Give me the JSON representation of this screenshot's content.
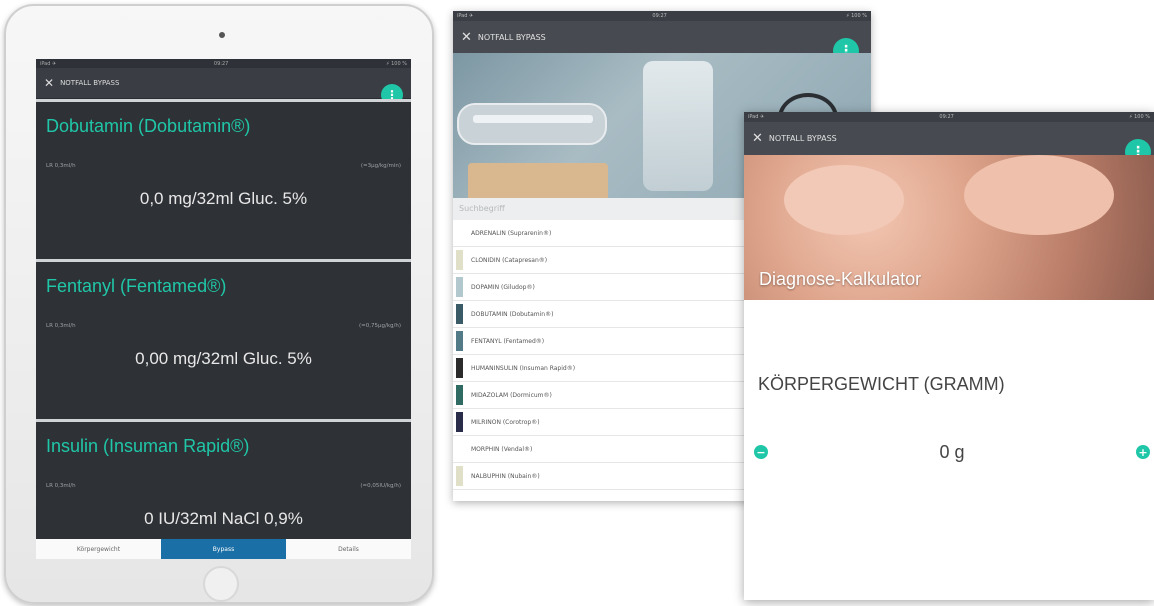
{
  "left_screen": {
    "appbar_title": "NOTFALL BYPASS",
    "status": {
      "carrier": "iPad ✈",
      "time": "09:27",
      "battery": "⚡ 100 %"
    },
    "drugs": [
      {
        "name": "Dobutamin (Dobutamin®)",
        "rate_label": "LR 0,3ml/h",
        "dose_label": "(=3µg/kg/min)",
        "concentration": "0,0 mg/32ml Gluc. 5%"
      },
      {
        "name": "Fentanyl (Fentamed®)",
        "rate_label": "LR 0,3ml/h",
        "dose_label": "(=0,75µg/kg/h)",
        "concentration": "0,00 mg/32ml Gluc. 5%"
      },
      {
        "name": "Insulin (Insuman Rapid®)",
        "rate_label": "LR 0,3ml/h",
        "dose_label": "(=0,05IU/kg/h)",
        "concentration": "0 IU/32ml NaCl 0,9%"
      }
    ],
    "tabs": [
      {
        "label": "Körpergewicht",
        "active": false
      },
      {
        "label": "Bypass",
        "active": true
      },
      {
        "label": "Details",
        "active": false
      }
    ]
  },
  "middle_screen": {
    "appbar_title": "NOTFALL BYPASS",
    "status": {
      "carrier": "iPad ✈",
      "time": "09:27",
      "battery": "⚡ 100 %"
    },
    "search_placeholder": "Suchbegriff",
    "medications": [
      {
        "label": "ADRENALIN (Suprarenin®)",
        "color": "#ffffff"
      },
      {
        "label": "CLONIDIN (Catapresan®)",
        "color": "#dfe0c7"
      },
      {
        "label": "DOPAMIN (Giludop®)",
        "color": "#b3c8ce"
      },
      {
        "label": "DOBUTAMIN (Dobutamin®)",
        "color": "#3a5a66"
      },
      {
        "label": "FENTANYL (Fentamed®)",
        "color": "#537b87"
      },
      {
        "label": "HUMANINSULIN (Insuman Rapid®)",
        "color": "#2b2b2b"
      },
      {
        "label": "MIDAZOLAM (Dormicum®)",
        "color": "#2f6b62"
      },
      {
        "label": "MILRINON (Corotrop®)",
        "color": "#2a2d4a"
      },
      {
        "label": "MORPHIN (Vendal®)",
        "color": "#ffffff"
      },
      {
        "label": "NALBUPHIN (Nubain®)",
        "color": "#dfe0c7"
      }
    ]
  },
  "right_screen": {
    "appbar_title": "NOTFALL BYPASS",
    "status": {
      "carrier": "iPad ✈",
      "time": "09:27",
      "battery": "⚡ 100 %"
    },
    "hero_title": "Diagnose-Kalkulator",
    "weight_label": "KÖRPERGEWICHT (GRAMM)",
    "weight_value": "0 g"
  },
  "icons": {
    "close": "close-icon",
    "menu": "more-vertical-icon",
    "minus": "minus-circle-icon",
    "plus": "plus-circle-icon"
  },
  "accent_color": "#1fc7a8"
}
